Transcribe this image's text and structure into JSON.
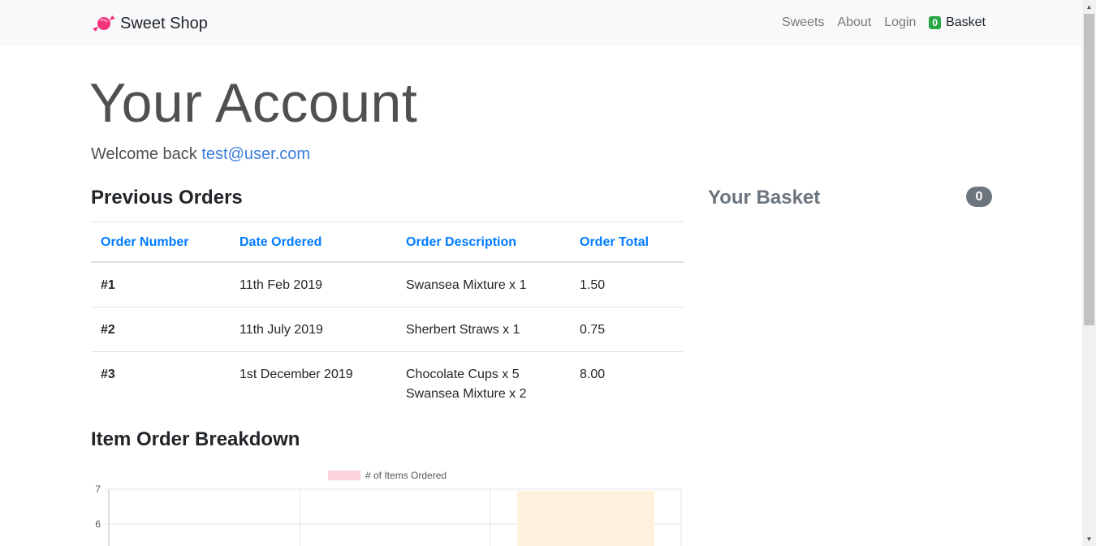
{
  "nav": {
    "brand": "Sweet Shop",
    "links": [
      "Sweets",
      "About",
      "Login"
    ],
    "basket_count": "0",
    "basket_label": "Basket"
  },
  "page": {
    "title": "Your Account",
    "welcome_text": "Welcome back",
    "user_email": "test@user.com"
  },
  "orders": {
    "title": "Previous Orders",
    "headers": [
      "Order Number",
      "Date Ordered",
      "Order Description",
      "Order Total"
    ],
    "rows": [
      {
        "number": "#1",
        "date": "11th Feb 2019",
        "desc": [
          "Swansea Mixture x 1"
        ],
        "total": "1.50"
      },
      {
        "number": "#2",
        "date": "11th July 2019",
        "desc": [
          "Sherbert Straws x 1"
        ],
        "total": "0.75"
      },
      {
        "number": "#3",
        "date": "1st December 2019",
        "desc": [
          "Chocolate Cups x 5",
          "Swansea Mixture x 2"
        ],
        "total": "8.00"
      }
    ]
  },
  "basket": {
    "title": "Your Basket",
    "count": "0"
  },
  "breakdown": {
    "title": "Item Order Breakdown"
  },
  "chart_data": {
    "type": "bar",
    "series": [
      {
        "name": "# of Items Ordered"
      }
    ],
    "categories": [
      "",
      "",
      ""
    ],
    "values": [
      null,
      null,
      7
    ],
    "ylim_visible": [
      5.4,
      7
    ],
    "yticks": [
      7,
      6
    ],
    "colors": {
      "legend": "#fbd3dc",
      "bar": "#fff1dc"
    }
  }
}
